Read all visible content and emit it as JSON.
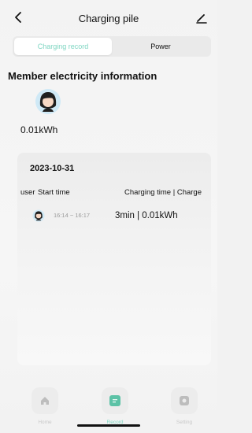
{
  "header": {
    "title": "Charging pile"
  },
  "tabs": [
    {
      "label": "Charging record",
      "active": true
    },
    {
      "label": "Power",
      "active": false
    }
  ],
  "section": {
    "title": "Member electricity information",
    "member_value": "0.01kWh"
  },
  "record": {
    "date": "2023-10-31",
    "columns": {
      "user": "user",
      "start_time": "Start time",
      "charge": "Charging time | Charge"
    },
    "rows": [
      {
        "time_range": "16:14 ~ 16:17",
        "charge": "3min | 0.01kWh"
      }
    ]
  },
  "nav": {
    "items": [
      {
        "label": "Home",
        "icon": "home-icon"
      },
      {
        "label": "Record",
        "icon": "record-icon",
        "active": true
      },
      {
        "label": "Setting",
        "icon": "settings-icon"
      }
    ]
  },
  "colors": {
    "accent": "#7fd6c2",
    "accent_dark": "#5cc2a6"
  }
}
